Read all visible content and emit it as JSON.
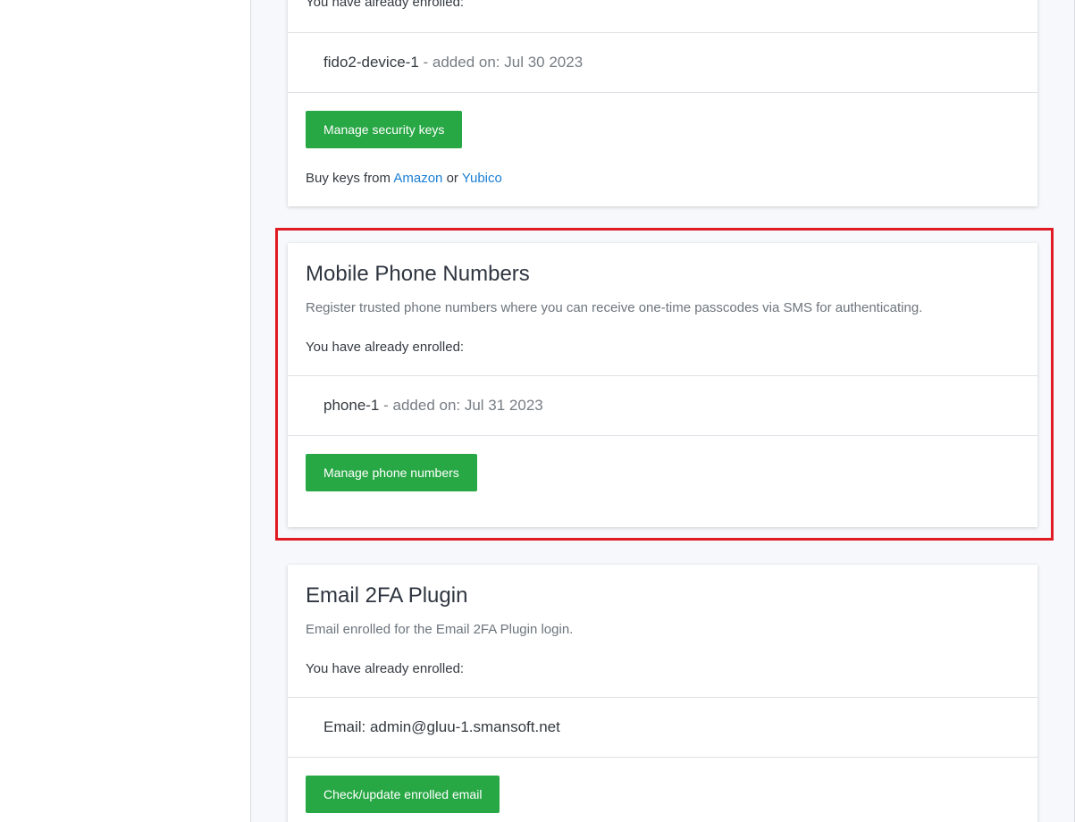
{
  "security_keys_card": {
    "enrolled_label": "You have already enrolled:",
    "device_name": "fido2-device-1",
    "device_meta": " - added on: Jul 30 2023",
    "manage_button": "Manage security keys",
    "buy_prefix": "Buy keys from ",
    "amazon_link": "Amazon",
    "or_text": " or ",
    "yubico_link": "Yubico"
  },
  "phone_card": {
    "title": "Mobile Phone Numbers",
    "description": "Register trusted phone numbers where you can receive one-time passcodes via SMS for authenticating.",
    "enrolled_label": "You have already enrolled:",
    "device_name": "phone-1",
    "device_meta": " - added on: Jul 31 2023",
    "manage_button": "Manage phone numbers"
  },
  "email_card": {
    "title": "Email 2FA Plugin",
    "description": "Email enrolled for the Email 2FA Plugin login.",
    "enrolled_label": "You have already enrolled:",
    "email_text": "Email: admin@gluu-1.smansoft.net",
    "manage_button": "Check/update enrolled email"
  },
  "colors": {
    "button_green": "#28a745",
    "link_blue": "#1a7fd4",
    "highlight_red": "#e01b24"
  }
}
